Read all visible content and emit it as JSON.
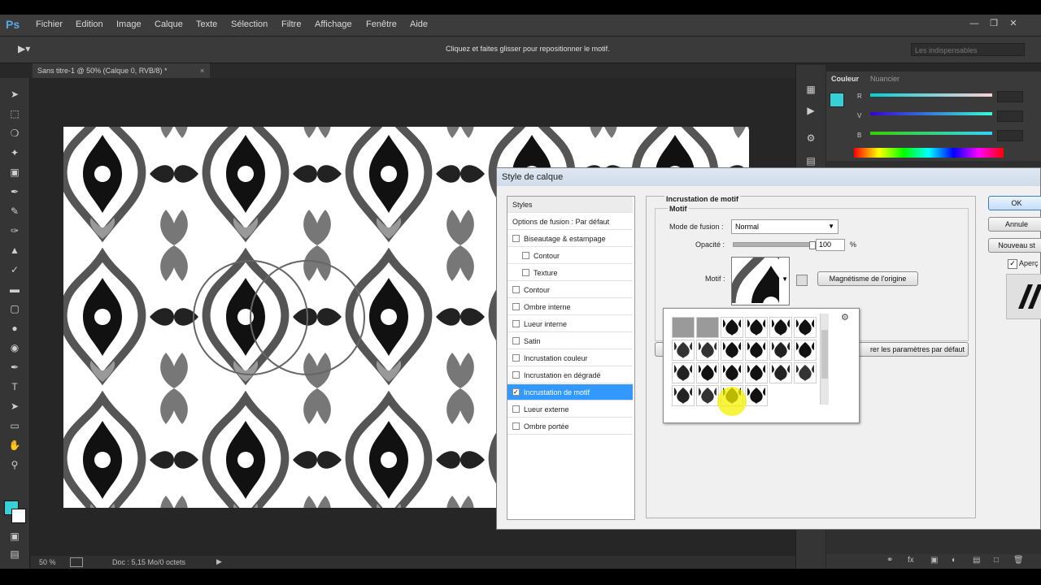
{
  "menubar": {
    "logo": "Ps",
    "items": [
      "Fichier",
      "Edition",
      "Image",
      "Calque",
      "Texte",
      "Sélection",
      "Filtre",
      "Affichage",
      "Fenêtre",
      "Aide"
    ]
  },
  "options_bar": {
    "hint": "Cliquez et faites glisser pour repositionner le motif.",
    "workspace": "Les indispensables"
  },
  "document": {
    "tab_title": "Sans titre-1 @ 50% (Calque 0, RVB/8) *",
    "zoom": "50 %",
    "doc_info": "Doc : 5,15 Mo/0 octets"
  },
  "color_panel": {
    "tabs": [
      "Couleur",
      "Nuancier"
    ],
    "channels": [
      "R",
      "V",
      "B"
    ],
    "fg_color": "#36d0d6",
    "bg_color": "#ffffff"
  },
  "dialog": {
    "title": "Style de calque",
    "styles_header": "Styles",
    "fusion_option": "Options de fusion : Par défaut",
    "effects": [
      {
        "label": "Biseautage & estampage",
        "checked": false,
        "indent": false,
        "selected": false
      },
      {
        "label": "Contour",
        "checked": false,
        "indent": true,
        "selected": false
      },
      {
        "label": "Texture",
        "checked": false,
        "indent": true,
        "selected": false
      },
      {
        "label": "Contour",
        "checked": false,
        "indent": false,
        "selected": false
      },
      {
        "label": "Ombre interne",
        "checked": false,
        "indent": false,
        "selected": false
      },
      {
        "label": "Lueur interne",
        "checked": false,
        "indent": false,
        "selected": false
      },
      {
        "label": "Satin",
        "checked": false,
        "indent": false,
        "selected": false
      },
      {
        "label": "Incrustation couleur",
        "checked": false,
        "indent": false,
        "selected": false
      },
      {
        "label": "Incrustation en dégradé",
        "checked": false,
        "indent": false,
        "selected": false
      },
      {
        "label": "Incrustation de motif",
        "checked": true,
        "indent": false,
        "selected": true
      },
      {
        "label": "Lueur externe",
        "checked": false,
        "indent": false,
        "selected": false
      },
      {
        "label": "Ombre portée",
        "checked": false,
        "indent": false,
        "selected": false
      }
    ],
    "section_title": "Incrustation de motif",
    "group_title": "Motif",
    "blend_mode_label": "Mode de fusion :",
    "blend_mode_value": "Normal",
    "opacity_label": "Opacité :",
    "opacity_value": "100",
    "opacity_unit": "%",
    "opacity_level": 1.0,
    "pattern_label": "Motif :",
    "snap_button": "Magnétisme de l'origine",
    "reset_button": "rer les paramètres par défaut",
    "ok_button": "OK",
    "cancel_button": "Annule",
    "new_style_button": "Nouveau st",
    "preview_label": "Aperç",
    "preview_checked": true
  },
  "colors": {
    "accent": "#3399ff",
    "selection": "#3399ff",
    "highlight": "#f6f200"
  }
}
